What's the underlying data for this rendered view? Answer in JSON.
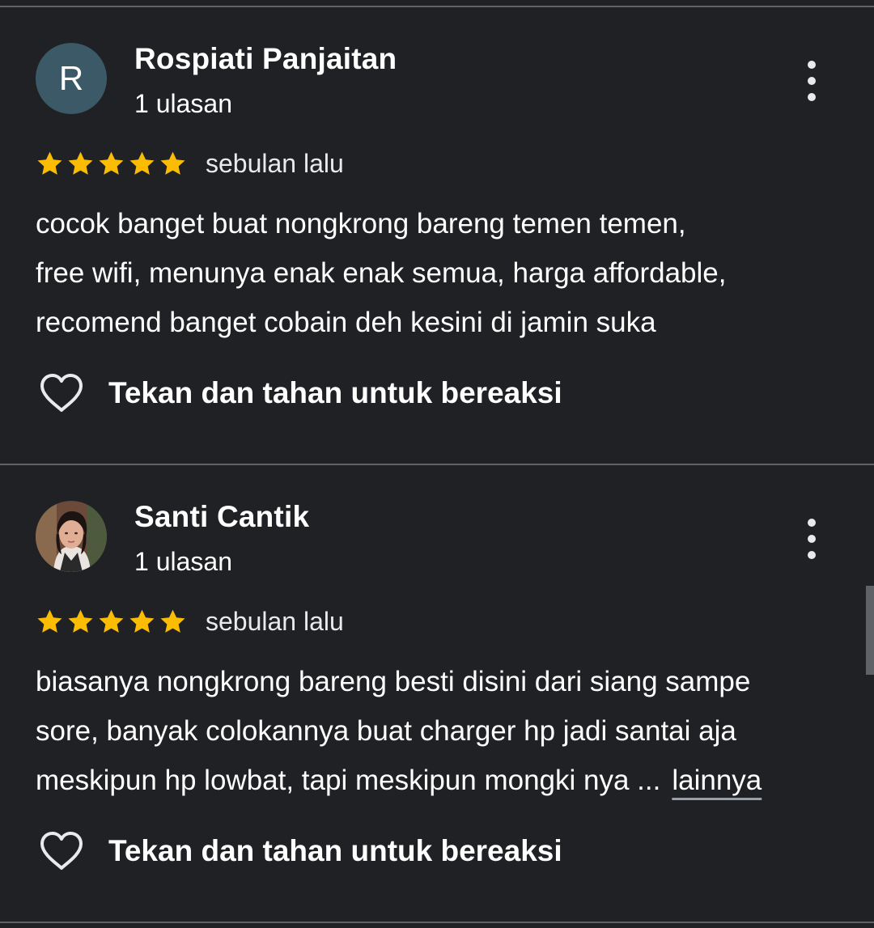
{
  "reviews": [
    {
      "name": "Rospiati Panjaitan",
      "avatar_letter": "R",
      "review_count": "1 ulasan",
      "rating": 5,
      "time": "sebulan lalu",
      "text_lines": [
        "cocok banget buat nongkrong bareng temen temen,",
        "free wifi, menunya enak enak semua, harga affordable,",
        "recomend banget cobain deh kesini di jamin suka"
      ],
      "react_label": "Tekan dan tahan untuk bereaksi"
    },
    {
      "name": "Santi Cantik",
      "review_count": "1 ulasan",
      "rating": 5,
      "time": "sebulan lalu",
      "text_lines": [
        "biasanya nongkrong bareng besti disini dari siang sampe",
        "sore, banyak colokannya buat charger hp jadi santai aja",
        "meskipun hp lowbat, tapi meskipun mongki nya ..."
      ],
      "more_link": "lainnya",
      "react_label": "Tekan dan tahan untuk bereaksi"
    }
  ],
  "icons": {
    "more": "more-vertical-icon",
    "star": "star-icon",
    "heart": "heart-outline-icon"
  },
  "colors": {
    "background": "#202124",
    "star": "#fbbc04",
    "divider": "#5f6368",
    "avatar_bg": "#3c5967"
  }
}
